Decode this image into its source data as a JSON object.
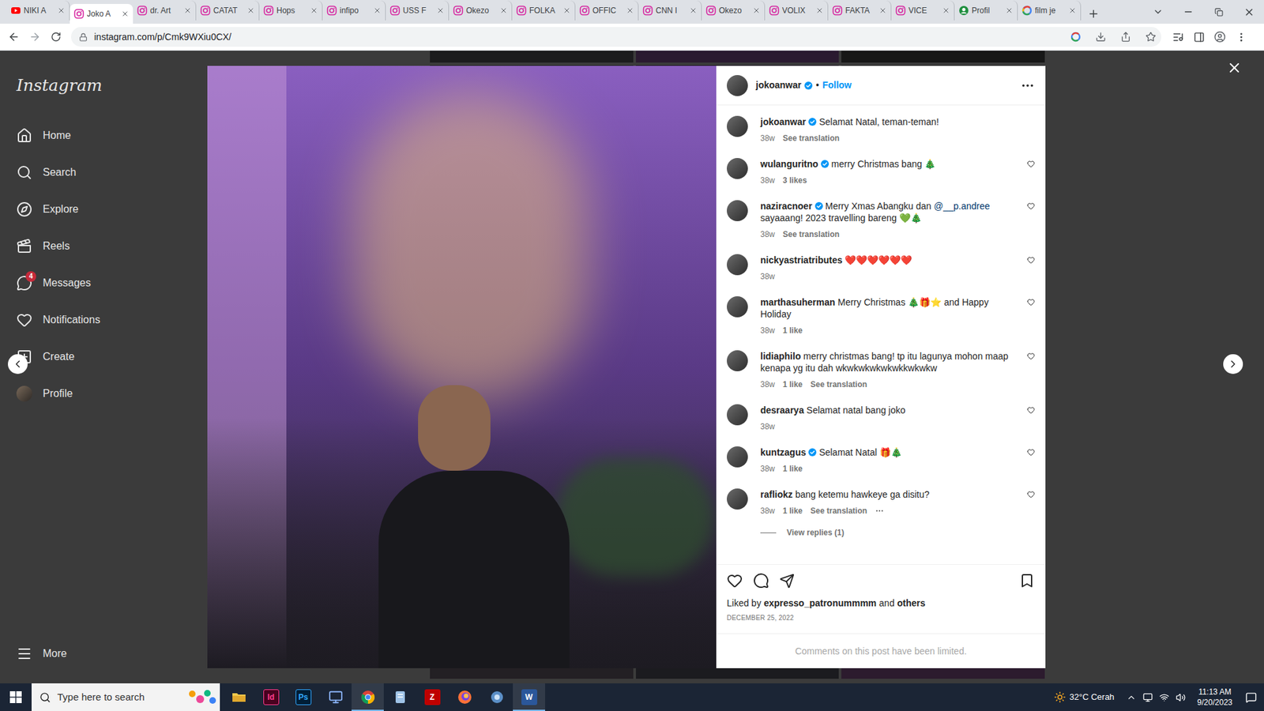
{
  "browser": {
    "tabs": [
      {
        "label": "NIKI A",
        "favicon": "youtube",
        "selected": false
      },
      {
        "label": "Joko A",
        "favicon": "instagram",
        "selected": true
      },
      {
        "label": "dr. Art",
        "favicon": "instagram",
        "selected": false
      },
      {
        "label": "CATAT",
        "favicon": "instagram",
        "selected": false
      },
      {
        "label": "Hops",
        "favicon": "instagram",
        "selected": false
      },
      {
        "label": "infipo",
        "favicon": "instagram",
        "selected": false
      },
      {
        "label": "USS F",
        "favicon": "instagram",
        "selected": false
      },
      {
        "label": "Okezo",
        "favicon": "instagram",
        "selected": false
      },
      {
        "label": "FOLKA",
        "favicon": "instagram",
        "selected": false
      },
      {
        "label": "OFFIC",
        "favicon": "instagram",
        "selected": false
      },
      {
        "label": "CNN I",
        "favicon": "instagram",
        "selected": false
      },
      {
        "label": "Okezo",
        "favicon": "instagram",
        "selected": false
      },
      {
        "label": "VOLIX",
        "favicon": "instagram",
        "selected": false
      },
      {
        "label": "FAKTA",
        "favicon": "instagram",
        "selected": false
      },
      {
        "label": "VICE",
        "favicon": "instagram",
        "selected": false
      },
      {
        "label": "Profil",
        "favicon": "profile",
        "selected": false
      },
      {
        "label": "film je",
        "favicon": "google",
        "selected": false
      }
    ],
    "url": "instagram.com/p/Cmk9WXiu0CX/"
  },
  "instagram": {
    "logo": "Instagram",
    "nav": [
      {
        "label": "Home",
        "kind": "home"
      },
      {
        "label": "Search",
        "kind": "search"
      },
      {
        "label": "Explore",
        "kind": "explore"
      },
      {
        "label": "Reels",
        "kind": "reels"
      },
      {
        "label": "Messages",
        "kind": "messages",
        "badge": "4"
      },
      {
        "label": "Notifications",
        "kind": "notifications"
      },
      {
        "label": "Create",
        "kind": "create"
      },
      {
        "label": "Profile",
        "kind": "profile"
      }
    ],
    "more": "More"
  },
  "post": {
    "author": "jokoanwar",
    "verified": true,
    "separator": "•",
    "follow": "Follow",
    "caption": {
      "user": "jokoanwar",
      "verified": true,
      "segments": [
        {
          "kind": "text",
          "text": "Selamat Natal, teman-teman!"
        }
      ],
      "time": "38w",
      "translation": "See translation",
      "more": false
    },
    "comments": [
      {
        "user": "wulanguritno",
        "verified": true,
        "segments": [
          {
            "kind": "text",
            "text": "merry Christmas bang 🎄"
          }
        ],
        "time": "38w",
        "likes": "3 likes",
        "more": false
      },
      {
        "user": "naziracnoer",
        "verified": true,
        "segments": [
          {
            "kind": "text",
            "text": "Merry Xmas Abangku dan"
          },
          {
            "kind": "mention",
            "text": "@__p.andree"
          },
          {
            "kind": "text",
            "text": "sayaaang! 2023 travelling bareng 💚🎄"
          }
        ],
        "time": "38w",
        "translation": "See translation",
        "more": false
      },
      {
        "user": "nickyastriatributes",
        "verified": false,
        "segments": [
          {
            "kind": "text",
            "text": "❤️❤️❤️❤️❤️❤️"
          }
        ],
        "time": "38w",
        "more": false
      },
      {
        "user": "marthasuherman",
        "verified": false,
        "segments": [
          {
            "kind": "text",
            "text": "Merry Christmas 🎄🎁⭐ and Happy Holiday"
          }
        ],
        "time": "38w",
        "likes": "1 like",
        "more": false
      },
      {
        "user": "lidiaphilo",
        "verified": false,
        "segments": [
          {
            "kind": "text",
            "text": "merry christmas bang! tp itu lagunya mohon maap kenapa yg itu dah wkwkwkwkwkwkkwkwkw"
          }
        ],
        "time": "38w",
        "likes": "1 like",
        "translation": "See translation",
        "more": false
      },
      {
        "user": "desraarya",
        "verified": false,
        "segments": [
          {
            "kind": "text",
            "text": "Selamat natal bang joko"
          }
        ],
        "time": "38w",
        "more": false
      },
      {
        "user": "kuntzagus",
        "verified": true,
        "segments": [
          {
            "kind": "text",
            "text": "Selamat Natal 🎁🎄"
          }
        ],
        "time": "38w",
        "likes": "1 like",
        "more": false
      },
      {
        "user": "rafliokz",
        "verified": false,
        "segments": [
          {
            "kind": "text",
            "text": "bang ketemu hawkeye ga disitu?"
          }
        ],
        "time": "38w",
        "likes": "1 like",
        "translation": "See translation",
        "more": true,
        "replies": "View replies (1)"
      }
    ],
    "liked_by": {
      "prefix": "Liked by",
      "user": "expresso_patronummmm",
      "joiner": "and",
      "others": "others"
    },
    "date": "DECEMBER 25, 2022",
    "limited": "Comments on this post have been limited."
  },
  "taskbar": {
    "search_placeholder": "Type here to search",
    "apps": [
      {
        "kind": "explorer",
        "active": false
      },
      {
        "kind": "indesign",
        "label": "Id",
        "active": false
      },
      {
        "kind": "photoshop",
        "label": "Ps",
        "active": false
      },
      {
        "kind": "app",
        "active": false
      },
      {
        "kind": "chrome",
        "active": true
      },
      {
        "kind": "notes",
        "active": false
      },
      {
        "kind": "filezilla",
        "label": "Z",
        "active": false
      },
      {
        "kind": "firefox",
        "active": false
      },
      {
        "kind": "tool",
        "active": false
      },
      {
        "kind": "word",
        "label": "W",
        "active": true
      }
    ],
    "weather": "32°C Cerah",
    "time": "11:13 AM",
    "date": "9/20/2023"
  }
}
